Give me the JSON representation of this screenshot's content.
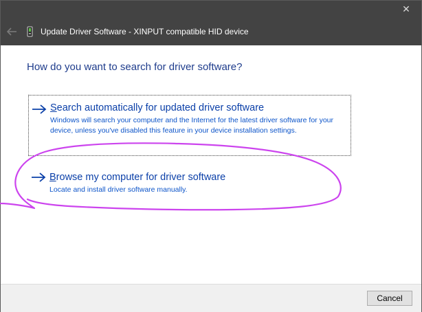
{
  "window": {
    "title": "Update Driver Software - XINPUT compatible HID device",
    "close_glyph": "✕"
  },
  "main": {
    "heading": "How do you want to search for driver software?",
    "options": [
      {
        "title_first": "S",
        "title_rest": "earch automatically for updated driver software",
        "description": "Windows will search your computer and the Internet for the latest driver software for your device, unless you've disabled this feature in your device installation settings."
      },
      {
        "title_first": "B",
        "title_rest": "rowse my computer for driver software",
        "description": "Locate and install driver software manually."
      }
    ]
  },
  "footer": {
    "cancel_label": "Cancel"
  },
  "icons": {
    "back": "back-arrow-icon",
    "device": "device-icon",
    "option_arrow": "right-arrow-icon"
  },
  "colors": {
    "chrome": "#434343",
    "heading": "#1e3c8c",
    "link": "#0a3fa8",
    "annotation": "#cc44ee"
  }
}
